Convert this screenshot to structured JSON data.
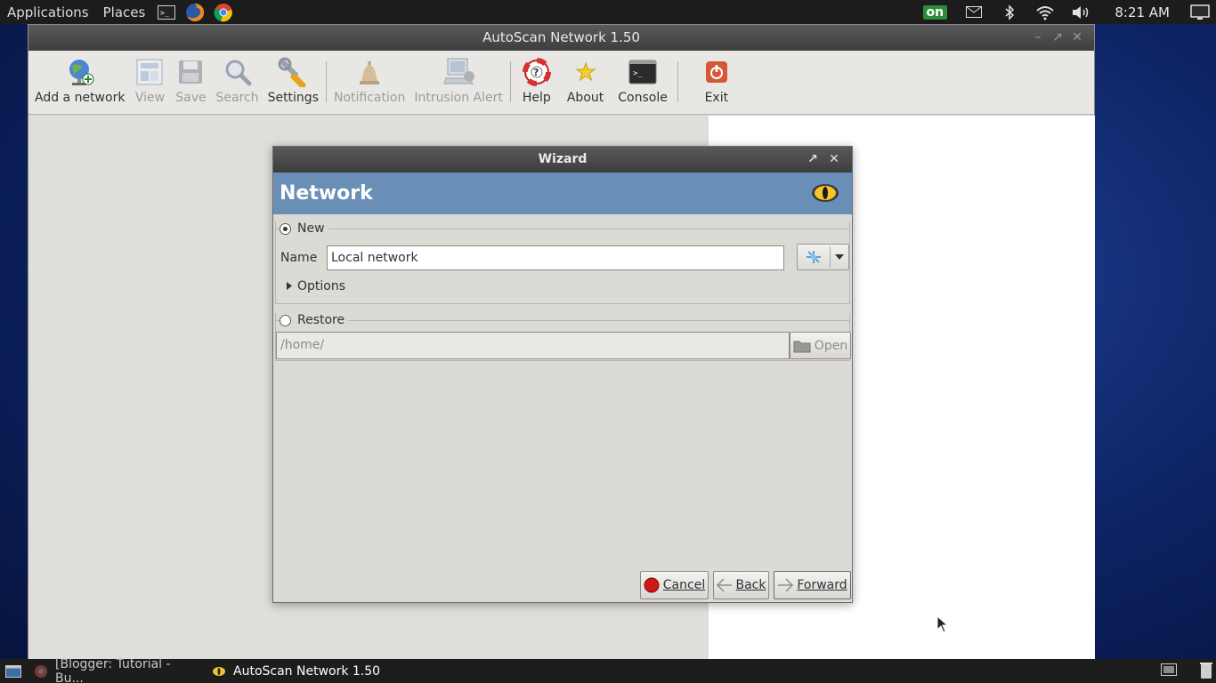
{
  "top_panel": {
    "applications": "Applications",
    "places": "Places",
    "launchers": [
      "terminal-icon",
      "firefox-icon",
      "chrome-icon"
    ],
    "tray": [
      "on-indicator",
      "mail-icon",
      "bluetooth-icon",
      "wifi-icon",
      "volume-icon"
    ],
    "on_badge": "on",
    "clock": "8:21 AM"
  },
  "main_window": {
    "title": "AutoScan Network 1.50",
    "toolbar": [
      {
        "label": "Add a network",
        "icon": "add-network-icon",
        "enabled": true
      },
      {
        "label": "View",
        "icon": "view-icon",
        "enabled": false
      },
      {
        "label": "Save",
        "icon": "save-icon",
        "enabled": false
      },
      {
        "label": "Search",
        "icon": "search-icon",
        "enabled": false
      },
      {
        "label": "Settings",
        "icon": "settings-icon",
        "enabled": true
      },
      {
        "label": "Notification",
        "icon": "notification-icon",
        "enabled": false
      },
      {
        "label": "Intrusion Alert",
        "icon": "intrusion-alert-icon",
        "enabled": false
      },
      {
        "label": "Help",
        "icon": "help-icon",
        "enabled": true
      },
      {
        "label": "About",
        "icon": "about-icon",
        "enabled": true
      },
      {
        "label": "Console",
        "icon": "console-icon",
        "enabled": true
      },
      {
        "label": "Exit",
        "icon": "exit-icon",
        "enabled": true
      }
    ]
  },
  "wizard": {
    "title": "Wizard",
    "header": "Network",
    "new_section": {
      "label": "New",
      "selected": true,
      "name_label": "Name",
      "name_value": "Local network",
      "options_label": "Options"
    },
    "restore_section": {
      "label": "Restore",
      "selected": false,
      "path_value": "/home/",
      "open_label": "Open"
    },
    "buttons": {
      "cancel": "Cancel",
      "back": "Back",
      "forward": "Forward"
    }
  },
  "taskbar": {
    "items": [
      {
        "label": "[Blogger: Tutorial - Bu...",
        "icon": "chrome-icon",
        "active": false
      },
      {
        "label": "AutoScan Network 1.50",
        "icon": "autoscan-icon",
        "active": true
      }
    ]
  },
  "colors": {
    "wizard_header": "#6a8fb6",
    "panel": "#1c1c1c",
    "desktop": "#0d2466"
  }
}
